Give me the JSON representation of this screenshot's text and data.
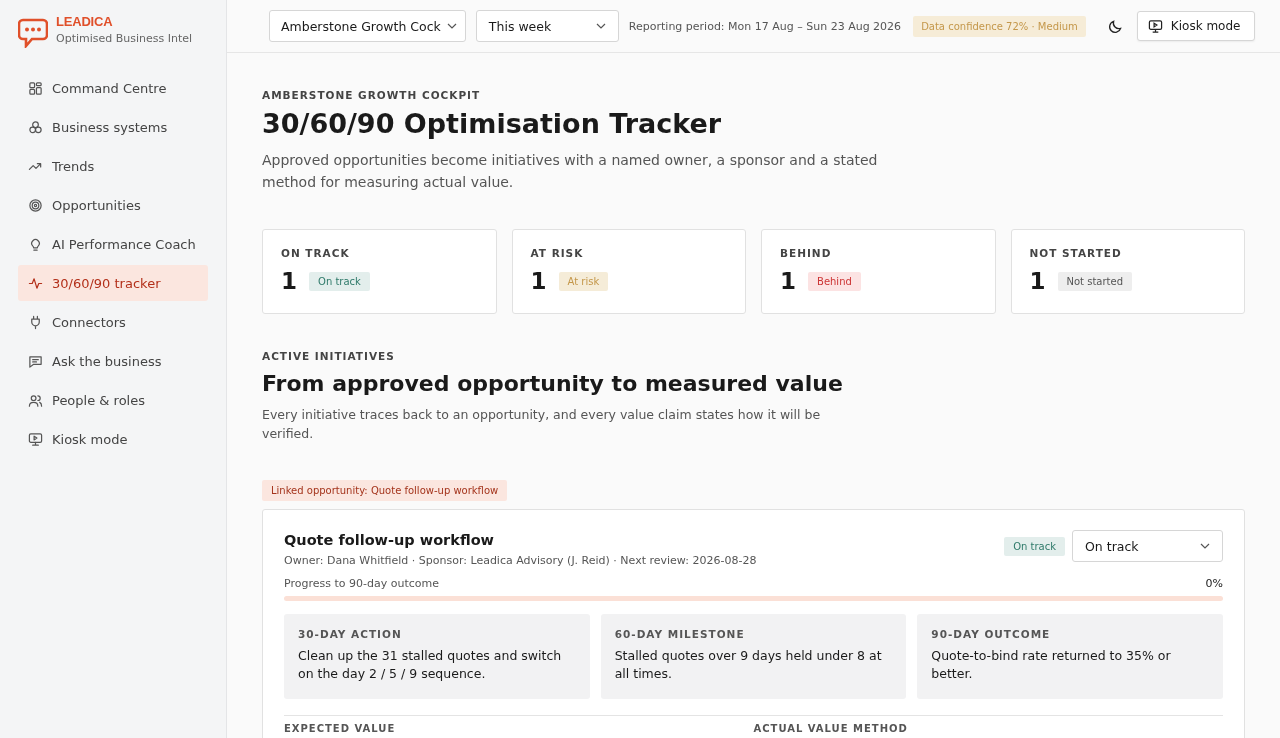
{
  "brand": {
    "name": "LEADICA",
    "tagline": "Optimised Business Intel"
  },
  "sidebar": {
    "items": [
      {
        "label": "Command Centre",
        "kind": "grid",
        "selected": false
      },
      {
        "label": "Business systems",
        "kind": "cubes",
        "selected": false
      },
      {
        "label": "Trends",
        "kind": "trend",
        "selected": false
      },
      {
        "label": "Opportunities",
        "kind": "target",
        "selected": false
      },
      {
        "label": "AI Performance Coach",
        "kind": "bulb",
        "selected": false
      },
      {
        "label": "30/60/90 tracker",
        "kind": "pulse",
        "selected": true
      },
      {
        "label": "Connectors",
        "kind": "plug",
        "selected": false
      },
      {
        "label": "Ask the business",
        "kind": "chat",
        "selected": false
      },
      {
        "label": "People & roles",
        "kind": "people",
        "selected": false
      },
      {
        "label": "Kiosk mode",
        "kind": "monitor",
        "selected": false
      }
    ]
  },
  "topbar": {
    "workspace": "Amberstone Growth Cock",
    "period_select": "This week",
    "reporting_period": "Reporting period: Mon 17 Aug – Sun 23 Aug 2026",
    "confidence": "Data confidence 72% · Medium",
    "kiosk_button": "Kiosk mode"
  },
  "header": {
    "eyebrow": "AMBERSTONE GROWTH COCKPIT",
    "title": "30/60/90 Optimisation Tracker",
    "description": "Approved opportunities become initiatives with a named owner, a sponsor and a stated method for measuring actual value."
  },
  "summary": [
    {
      "label": "ON TRACK",
      "count": "1",
      "badge": "On track",
      "kind": "on_track"
    },
    {
      "label": "AT RISK",
      "count": "1",
      "badge": "At risk",
      "kind": "at_risk"
    },
    {
      "label": "BEHIND",
      "count": "1",
      "badge": "Behind",
      "kind": "behind"
    },
    {
      "label": "NOT STARTED",
      "count": "1",
      "badge": "Not started",
      "kind": "not_started"
    }
  ],
  "section": {
    "eyebrow": "ACTIVE INITIATIVES",
    "title": "From approved opportunity to measured value",
    "description": "Every initiative traces back to an opportunity, and every value claim states how it will be verified."
  },
  "initiatives": [
    {
      "linked": "Linked opportunity: Quote follow-up workflow",
      "title": "Quote follow-up workflow",
      "meta": "Owner: Dana Whitfield · Sponsor: Leadica Advisory (J. Reid) · Next review: 2026-08-28",
      "kind": "on_track",
      "badge": "On track",
      "status_select": "On track",
      "progress_label": "Progress to 90-day outcome",
      "progress_value": "0%",
      "level": 0,
      "stages": [
        {
          "label": "30-DAY ACTION",
          "text": "Clean up the 31 stalled quotes and switch on the day 2 / 5 / 9 sequence."
        },
        {
          "label": "60-DAY MILESTONE",
          "text": "Stalled quotes over 9 days held under 8 at all times."
        },
        {
          "label": "90-DAY OUTCOME",
          "text": "Quote-to-bind rate returned to 35% or better."
        }
      ],
      "footer_labels": [
        "EXPECTED VALUE",
        "ACTUAL VALUE METHOD"
      ]
    }
  ]
}
